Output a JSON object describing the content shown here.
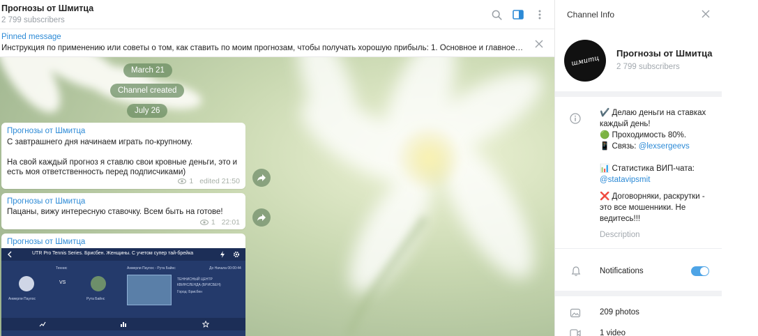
{
  "header": {
    "title": "Прогнозы от Шмитца",
    "subtitle": "2 799 subscribers",
    "icons": [
      "search-icon",
      "sidebar-toggle-icon",
      "more-vertical-icon"
    ]
  },
  "pinned": {
    "title": "Pinned message",
    "text": "Инструкция по применению или советы о том, как ставить по моим прогнозам, чтобы получать хорошую прибыль:  1. Основное и главное пр..."
  },
  "service": {
    "date1": "March 21",
    "created": "Channel created",
    "date2": "July 26"
  },
  "messages": [
    {
      "author": "Прогнозы от Шмитца",
      "line1": "С завтрашнего дня начинаем играть по-крупному.",
      "line2": "На свой каждый прогноз я ставлю свои кровные деньги, это и",
      "line3": "есть моя ответственность перед подписчиками)",
      "views": "1",
      "time": "edited 21:50"
    },
    {
      "author": "Прогнозы от Шмитца",
      "line1": "Пацаны, вижу интересную ставочку. Всем быть на готове!",
      "views": "1",
      "time": "22:01"
    },
    {
      "author": "Прогнозы от Шмитца",
      "media": {
        "bar_text": "UTR Pro Tennis Series. Брисбен. Женщины. С учетом супер тай-брейка",
        "players": "Анмерли Паулос - Рута Байнс",
        "countdown": "До Начала 00:00:44",
        "venue1": "ТЕННИСНЫЙ ЦЕНТР",
        "venue2": "КВИНСЛЕНДА (БРИСБЕН)",
        "city": "Город: Брисбен",
        "player1": "Анмерли Паулос",
        "player2": "Рута Байнс",
        "vs": "VS",
        "tab_label": "Теннис"
      }
    }
  ],
  "info": {
    "header": "Channel Info",
    "avatar_text": "шмитц",
    "name": "Прогнозы от Шмитца",
    "subscribers": "2 799 subscribers",
    "desc": [
      "✔️ Делаю деньги на ставках",
      "каждый день!",
      "🟢 Проходимость 80%.",
      "📱 Связь: ",
      "📊 Статистика ВИП-чата:",
      "❌ Договорняки, раскрутки -",
      "это все мошенники. Не",
      "ведитесь!!!"
    ],
    "contact_link": "@lexsergeevs",
    "stats_link": "@statavipsmit",
    "desc_label": "Description",
    "notifications_label": "Notifications",
    "notifications_on": true,
    "photos": "209 photos",
    "videos": "1 video"
  },
  "colors": {
    "link": "#2c8ad6",
    "toggle": "#4ea4e6",
    "service_pill": "#688a60"
  }
}
